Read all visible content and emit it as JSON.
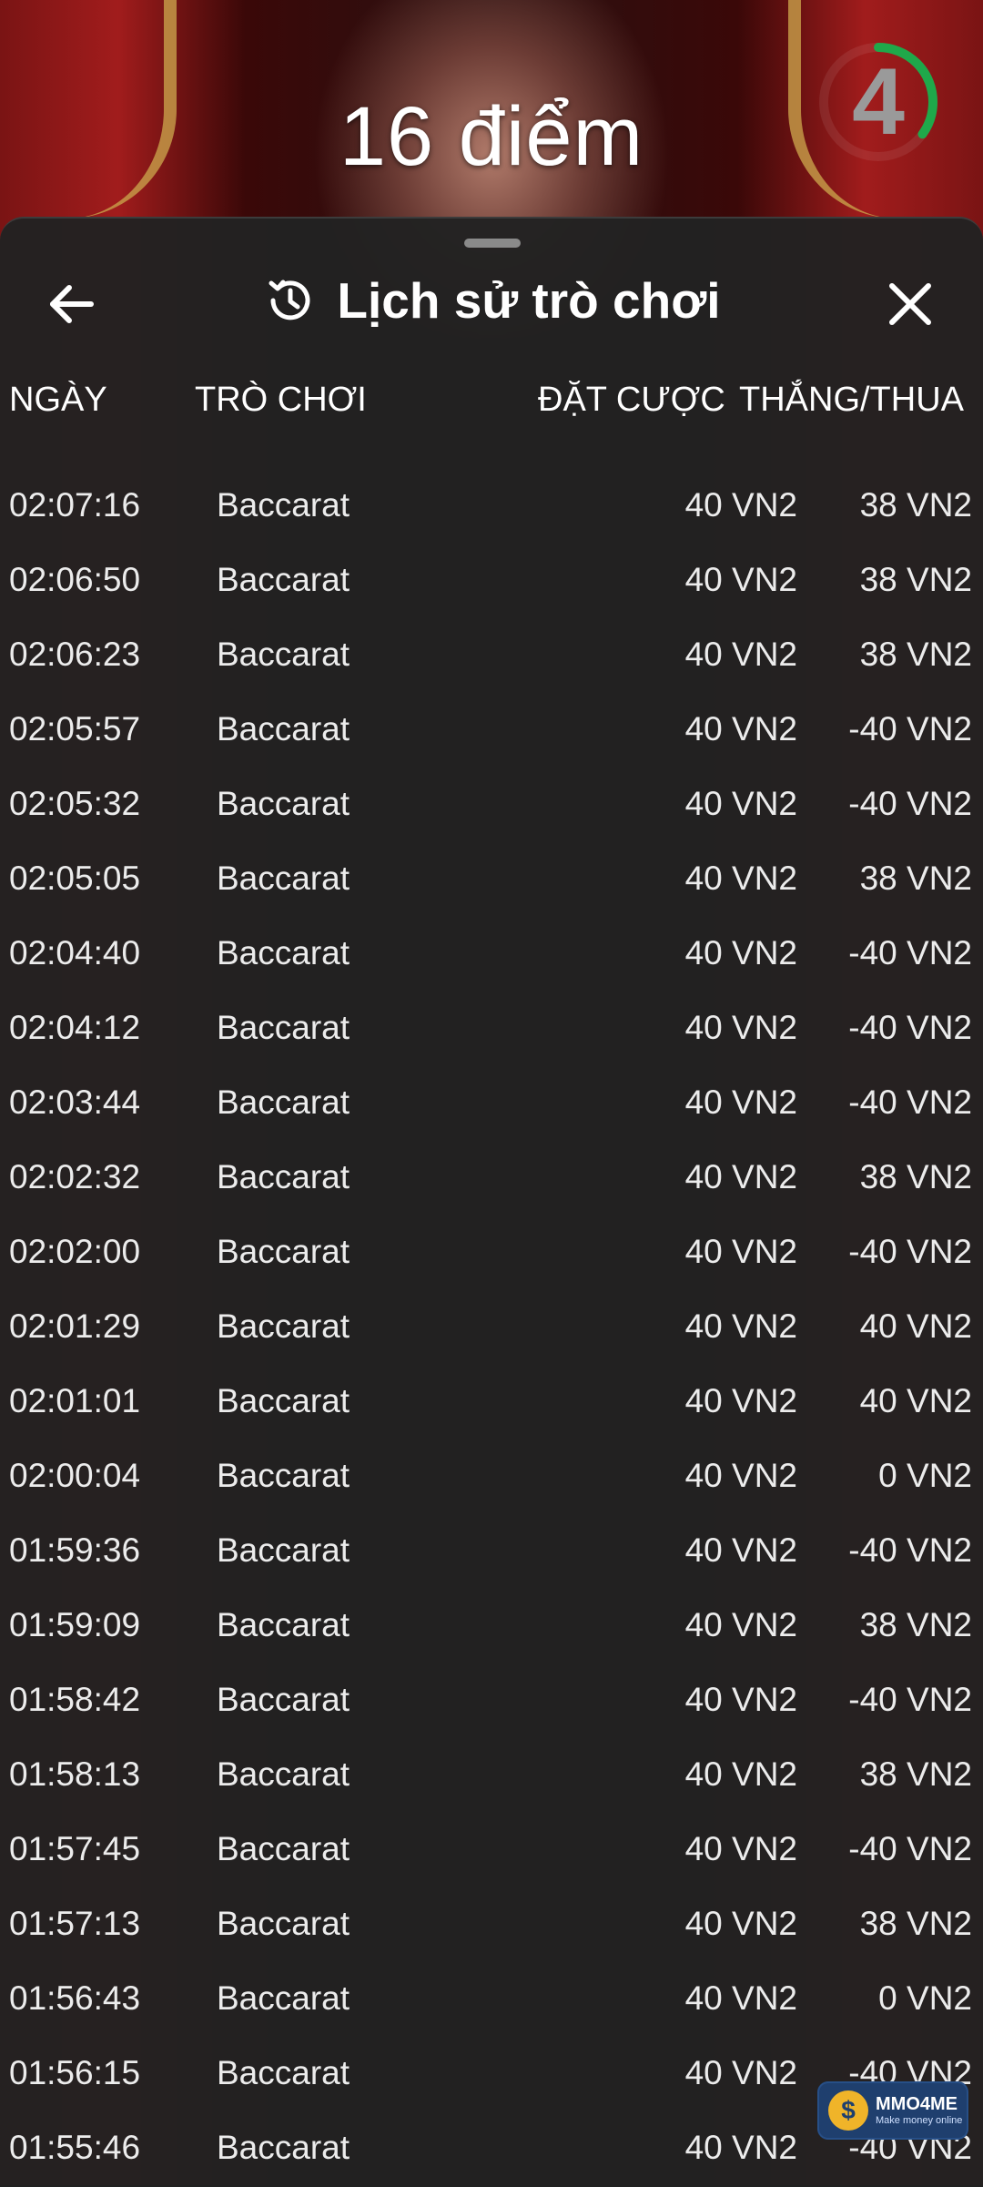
{
  "game": {
    "points_label": "16 điểm",
    "timer_value": "4",
    "timer_fraction": 0.35,
    "timer_color": "#1fa84a"
  },
  "history": {
    "title": "Lịch sử trò chơi",
    "back_icon": "arrow-left-icon",
    "history_icon": "history-clock-icon",
    "close_icon": "close-icon",
    "columns": {
      "date": "NGÀY",
      "game": "TRÒ CHƠI",
      "bet": "ĐẶT CƯỢC",
      "win_loss": "THẮNG/THUA"
    },
    "rows": [
      {
        "time": "02:07:16",
        "game": "Baccarat",
        "bet": "40 VN2",
        "result": "38 VN2"
      },
      {
        "time": "02:06:50",
        "game": "Baccarat",
        "bet": "40 VN2",
        "result": "38 VN2"
      },
      {
        "time": "02:06:23",
        "game": "Baccarat",
        "bet": "40 VN2",
        "result": "38 VN2"
      },
      {
        "time": "02:05:57",
        "game": "Baccarat",
        "bet": "40 VN2",
        "result": "-40 VN2"
      },
      {
        "time": "02:05:32",
        "game": "Baccarat",
        "bet": "40 VN2",
        "result": "-40 VN2"
      },
      {
        "time": "02:05:05",
        "game": "Baccarat",
        "bet": "40 VN2",
        "result": "38 VN2"
      },
      {
        "time": "02:04:40",
        "game": "Baccarat",
        "bet": "40 VN2",
        "result": "-40 VN2"
      },
      {
        "time": "02:04:12",
        "game": "Baccarat",
        "bet": "40 VN2",
        "result": "-40 VN2"
      },
      {
        "time": "02:03:44",
        "game": "Baccarat",
        "bet": "40 VN2",
        "result": "-40 VN2"
      },
      {
        "time": "02:02:32",
        "game": "Baccarat",
        "bet": "40 VN2",
        "result": "38 VN2"
      },
      {
        "time": "02:02:00",
        "game": "Baccarat",
        "bet": "40 VN2",
        "result": "-40 VN2"
      },
      {
        "time": "02:01:29",
        "game": "Baccarat",
        "bet": "40 VN2",
        "result": "40 VN2"
      },
      {
        "time": "02:01:01",
        "game": "Baccarat",
        "bet": "40 VN2",
        "result": "40 VN2"
      },
      {
        "time": "02:00:04",
        "game": "Baccarat",
        "bet": "40 VN2",
        "result": "0 VN2"
      },
      {
        "time": "01:59:36",
        "game": "Baccarat",
        "bet": "40 VN2",
        "result": "-40 VN2"
      },
      {
        "time": "01:59:09",
        "game": "Baccarat",
        "bet": "40 VN2",
        "result": "38 VN2"
      },
      {
        "time": "01:58:42",
        "game": "Baccarat",
        "bet": "40 VN2",
        "result": "-40 VN2"
      },
      {
        "time": "01:58:13",
        "game": "Baccarat",
        "bet": "40 VN2",
        "result": "38 VN2"
      },
      {
        "time": "01:57:45",
        "game": "Baccarat",
        "bet": "40 VN2",
        "result": "-40 VN2"
      },
      {
        "time": "01:57:13",
        "game": "Baccarat",
        "bet": "40 VN2",
        "result": "38 VN2"
      },
      {
        "time": "01:56:43",
        "game": "Baccarat",
        "bet": "40 VN2",
        "result": "0 VN2"
      },
      {
        "time": "01:56:15",
        "game": "Baccarat",
        "bet": "40 VN2",
        "result": "-40 VN2"
      },
      {
        "time": "01:55:46",
        "game": "Baccarat",
        "bet": "40 VN2",
        "result": "-40 VN2"
      }
    ]
  },
  "watermark": {
    "name": "MMO4ME",
    "tagline": "Make money online"
  },
  "colors": {
    "sheet_bg": "#222222",
    "text": "#ececec"
  }
}
